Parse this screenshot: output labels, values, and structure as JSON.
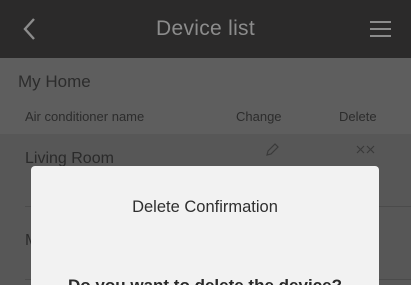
{
  "header": {
    "title": "Device list",
    "back_icon": "chevron-left-icon",
    "menu_icon": "hamburger-menu-icon"
  },
  "home": {
    "title": "My Home"
  },
  "table": {
    "columns": {
      "name": "Air conditioner name",
      "change": "Change",
      "delete": "Delete"
    },
    "rows": [
      {
        "label": "Living Room"
      },
      {
        "label": "M"
      }
    ]
  },
  "dialog": {
    "title": "Delete Confirmation",
    "message": "Do you want to delete the device?"
  },
  "colors": {
    "header_bg": "#2b2a2a",
    "header_text": "#8c8c8c",
    "overlay_bg": "#5e5e5e",
    "dialog_bg": "#f2f2f2"
  }
}
